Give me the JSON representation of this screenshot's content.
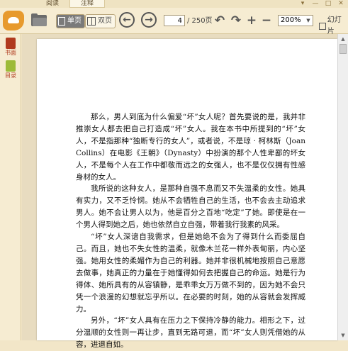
{
  "tabs": [
    {
      "label": "阅读",
      "active": false
    },
    {
      "label": "注释",
      "active": true
    }
  ],
  "toolbar": {
    "single_page_label": "单页",
    "double_page_label": "双页",
    "current_page": "4",
    "total_pages": "/ 250页",
    "zoom_value": "200%",
    "slideshow_label": "幻灯片",
    "prev_glyph": "←",
    "next_glyph": "→",
    "undo_glyph": "↶",
    "redo_glyph": "↷",
    "zoom_in_glyph": "+",
    "zoom_out_glyph": "−"
  },
  "sidebar": {
    "items": [
      {
        "label": "书面",
        "icon": "book-icon"
      },
      {
        "label": "目录",
        "icon": "toc-icon"
      }
    ]
  },
  "window_controls": [
    "▾",
    "—",
    "□",
    "✕"
  ],
  "page_text": {
    "paragraphs": [
      "那么，男人到底为什么偏爱“坏”女人呢？首先要说的是，我并非推崇女人都去把自己打造成“坏”女人。我在本书中所提到的“坏”女人，不是指那种“独断专行的女人”，或者说，不是琼 · 柯林斯（Joan Collins）在电影《王朝》（Dynasty）中扮演的那个人性卑鄙的坏女人，不是每个人在工作中都敬而远之的女强人，也不是仅仅拥有性感身材的女人。",
      "我所说的这种女人，是那种自强不息而又不失温柔的女性。她具有实力，又不乏怜悯。她从不会牺牲自己的生活，也不会去主动追求男人。她不会让男人以为，他是百分之百地“吃定”了她。即使是在一个男人得到她之后，她也依然自立自强，带着我行我素的风采。",
      "“坏”女人深谙自我需求，但是她绝不会为了得到什么而委屈自己。而且，她也不失女性的温柔，就像木兰花一样外表甸丽，内心坚强。她用女性的柔媚作为自己的利器。她并非很机械地按照自己意愿去做事，她真正的力量在于她懂得如何去把握自己的命运。她是行为得体、她所具有的从容镇静，是乖乖女万万做不到的，因为她不会只凭一个浪漫的幻想就忘乎所以。在必要的时刻，她的从容就会发挥威力。",
      "另外，“坏”女人具有在压力之下保持冷静的能力。相形之下，过分温顺的女性则一再让步，直到无路可退，而“坏”女人则凭借她的从容，进退自如。"
    ]
  }
}
